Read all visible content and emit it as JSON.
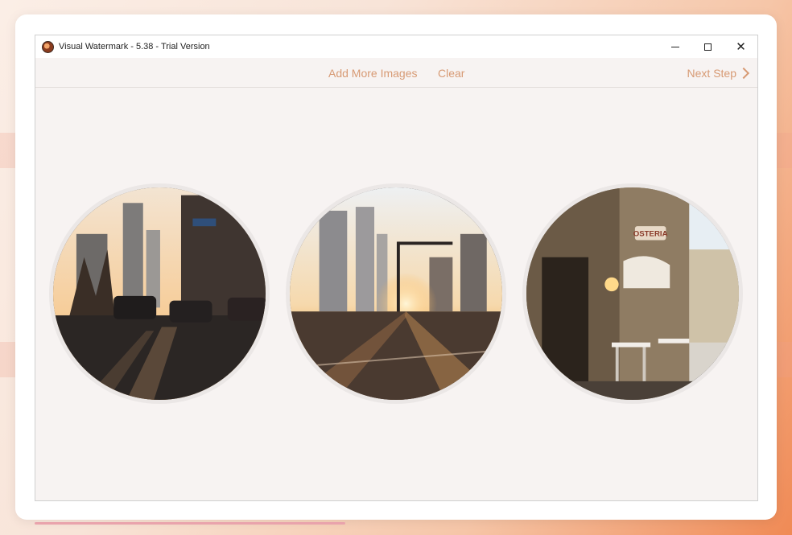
{
  "window": {
    "title": "Visual Watermark - 5.38 - Trial Version",
    "controls": [
      "minimize-icon",
      "maximize-icon",
      "close-icon"
    ]
  },
  "toolbar": {
    "add_more_label": "Add More Images",
    "clear_label": "Clear",
    "next_step_label": "Next Step"
  },
  "images": [
    {
      "scene": "city street at sunset with parked cars"
    },
    {
      "scene": "city intersection with sun between skyscrapers"
    },
    {
      "scene": "european street cafe with osteria sign",
      "sign_text": "OSTERIA"
    }
  ],
  "colors": {
    "accent": "#d79a74",
    "window_bg": "#f7f3f2",
    "card_bg": "#ffffff"
  }
}
